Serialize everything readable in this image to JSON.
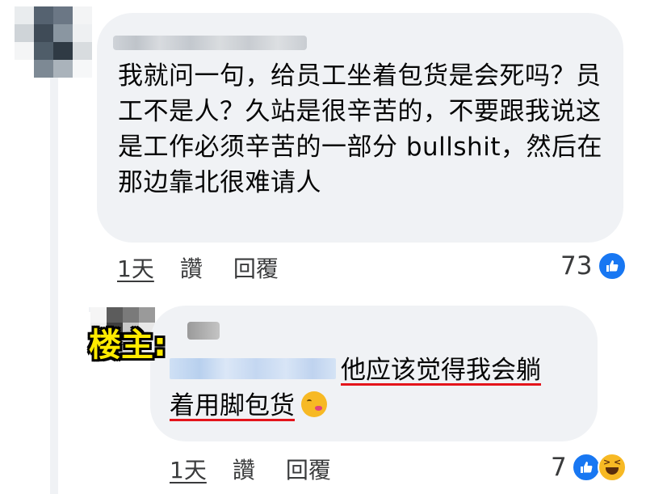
{
  "comment": {
    "text": "我就问一句，给员工坐着包货是会死吗？员工不是人？久站是很辛苦的，不要跟我说这是工作必须辛苦的一部分 bullshit，然后在那边靠北很难请人",
    "time": "1天",
    "like_label": "讚",
    "reply_label": "回覆",
    "reaction_count": "73",
    "reaction_icons": [
      "like-icon"
    ]
  },
  "reply": {
    "badge": "楼主:",
    "text_line1": "他应该觉得我会躺",
    "text_line2": "着用脚包货",
    "emoji": "woozy-face-icon",
    "time": "1天",
    "like_label": "讚",
    "reply_label": "回覆",
    "reaction_count": "7",
    "reaction_icons": [
      "like-icon",
      "haha-icon"
    ]
  },
  "colors": {
    "bubble": "#f0f2f5",
    "like_blue": "#1877f2",
    "badge_yellow": "#ffeb00",
    "underline_red": "#e4141b"
  }
}
